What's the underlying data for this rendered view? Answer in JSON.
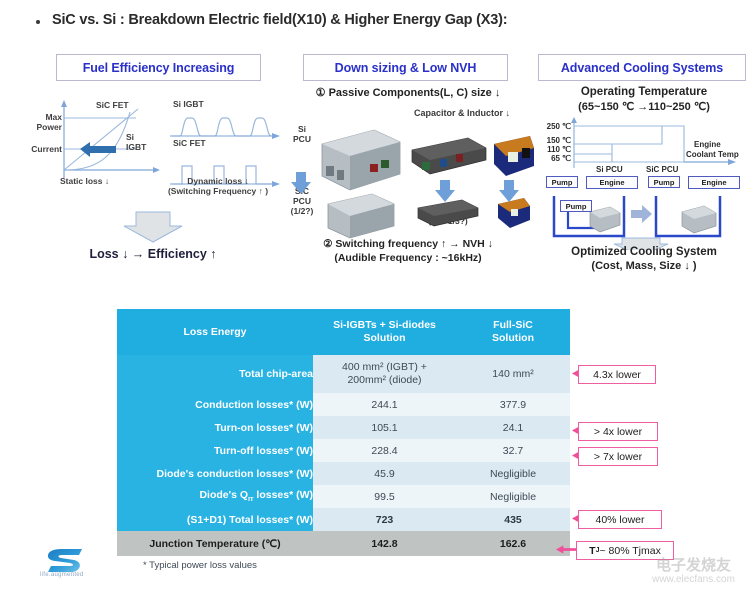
{
  "slide": {
    "title": "SiC vs. Si : Breakdown Electric field(X10) & Higher Energy Gap (X3):"
  },
  "headers": [
    {
      "label": "Fuel Efficiency Increasing"
    },
    {
      "label": "Down sizing & Low NVH"
    },
    {
      "label": "Advanced Cooling Systems"
    }
  ],
  "panel_left": {
    "y_axis_top": "Max\nPower",
    "y_axis_top_line1": "Max",
    "y_axis_top_line2": "Power",
    "y_axis_mid": "Current",
    "curve_upper": "SiC FET",
    "curve_lower_line1": "Si",
    "curve_lower_line2": "IGBT",
    "static_loss": "Static loss ↓",
    "wave_top_label": "Si IGBT",
    "wave_bottom_label": "SiC FET",
    "dynamic_loss_line1": "Dynamic loss ↓",
    "dynamic_loss_line2": "(Switching Frequency ↑ )",
    "conclusion": "Loss ↓  →  Efficiency ↑"
  },
  "panel_mid": {
    "title": "① Passive Components(L, C) size ↓",
    "cap_ind": "Capacitor & Inductor ↓",
    "si_pcu_line1": "Si",
    "si_pcu_line2": "PCU",
    "sic_pcu_line1": "SiC",
    "sic_pcu_line2": "PCU",
    "sic_pcu_line3": "(1/2?)",
    "fraction_note": "(1/2~1/3?)",
    "footer_line1": "② Switching frequency ↑ → NVH ↓",
    "footer_line2": "(Audible Frequency : ~16kHz)"
  },
  "panel_right": {
    "title_line1": "Operating Temperature",
    "title_line2": "(65~150 ℃ →110~250 ℃)",
    "ticks": [
      "250 ℃",
      "150 ℃",
      "110 ℃",
      "65 ℃"
    ],
    "tick_250": "250",
    "tick_150": "150",
    "tick_110": "110",
    "tick_65": "65",
    "deg": "℃",
    "bar_si": "Si PCU",
    "bar_sic": "SiC PCU",
    "coolant_line1": "Engine",
    "coolant_line2": "Coolant Temp",
    "pump": "Pump",
    "engine": "Engine",
    "footer_line1": "Optimized Cooling System",
    "footer_line2": "(Cost, Mass, Size ↓ )"
  },
  "table": {
    "headers": {
      "col1": "Loss Energy",
      "col2_line1": "Si-IGBTs + Si-diodes",
      "col2_line2": "Solution",
      "col3_line1": "Full-SiC",
      "col3_line2": "Solution"
    },
    "rows": [
      {
        "label": "Total chip-area",
        "si_line1": "400 mm² (IGBT) +",
        "si_line2": "200mm² (diode)",
        "sic": "140 mm²"
      },
      {
        "label": "Conduction losses* (W)",
        "si": "244.1",
        "sic": "377.9"
      },
      {
        "label": "Turn-on losses* (W)",
        "si": "105.1",
        "sic": "24.1"
      },
      {
        "label": "Turn-off losses* (W)",
        "si": "228.4",
        "sic": "32.7"
      },
      {
        "label": "Diode's conduction losses* (W)",
        "si": "45.9",
        "sic": "Negligible"
      },
      {
        "label": "Diode's Qrr losses* (W)",
        "label_main": "Diode's Q",
        "label_sub": "rr",
        "label_tail": " losses* (W)",
        "si": "99.5",
        "sic": "Negligible"
      },
      {
        "label": "(S1+D1) Total losses* (W)",
        "si": "723",
        "sic": "435"
      },
      {
        "label": "Junction Temperature (℃)",
        "si": "142.8",
        "sic": "162.6"
      }
    ],
    "footnote": "* Typical power loss values"
  },
  "callouts": [
    {
      "label": "4.3x lower"
    },
    {
      "label": "> 4x lower"
    },
    {
      "label": "> 7x lower"
    },
    {
      "label": "40% lower"
    },
    {
      "label": "TJ ~ 80% Tjmax",
      "main": "T",
      "sub": "J",
      "tail": " ~ 80% Tjmax"
    }
  ],
  "branding": {
    "logo_name": "ST",
    "tagline": "life.augmented"
  },
  "watermark": {
    "chinese": "电子发烧友",
    "url": "www.elecfans.com"
  },
  "colors": {
    "table_header_blue": "#20ADE0",
    "row_label_blue": "#29B3E0",
    "callout_pink": "#ef5fa0",
    "title_blue": "#2a30c8",
    "final_row_gray": "#bfc3c2"
  }
}
